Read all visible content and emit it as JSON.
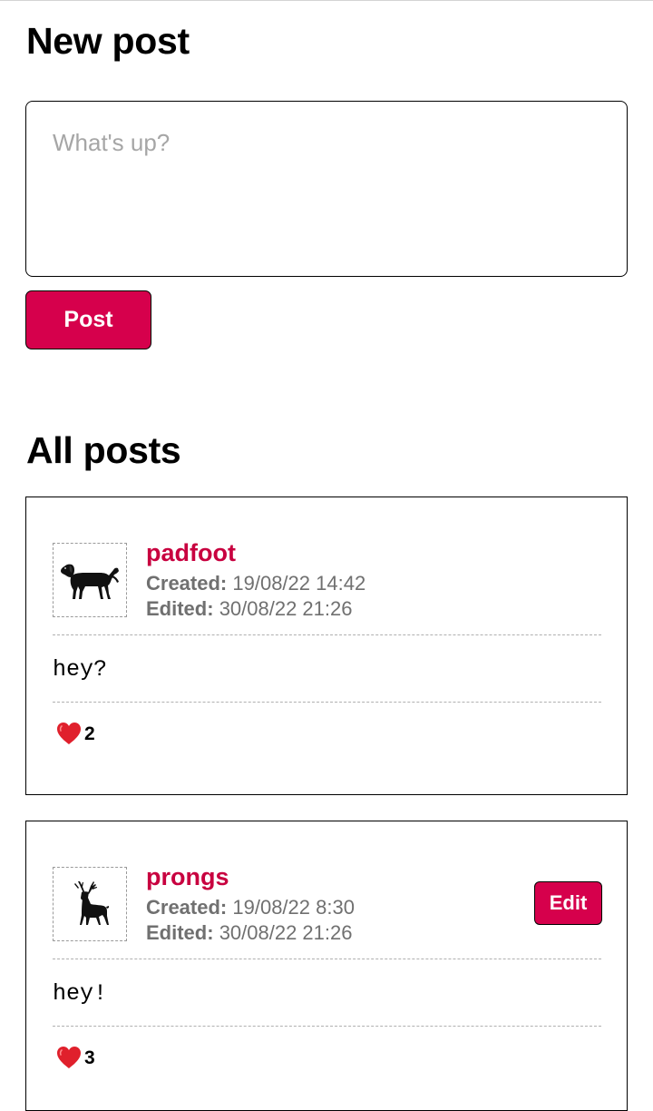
{
  "new_post": {
    "title": "New post",
    "placeholder": "What's up?",
    "value": "",
    "submit_label": "Post"
  },
  "feed": {
    "title": "All posts",
    "posts": [
      {
        "username": "padfoot",
        "avatar": "dog-icon",
        "created_label": "Created:",
        "created": "19/08/22 14:42",
        "edited_label": "Edited:",
        "edited": "30/08/22 21:26",
        "content": "hey?",
        "like_icon": "heart-icon",
        "likes": "2",
        "editable": false
      },
      {
        "username": "prongs",
        "avatar": "stag-icon",
        "created_label": "Created:",
        "created": "19/08/22 8:30",
        "edited_label": "Edited:",
        "edited": "30/08/22 21:26",
        "content": "hey!",
        "like_icon": "heart-icon",
        "likes": "3",
        "editable": true,
        "edit_label": "Edit"
      }
    ]
  },
  "colors": {
    "accent": "#d6004c",
    "username": "#c8003f",
    "meta_text": "#707070",
    "placeholder": "#a6a6a6",
    "heart": "#e0202c"
  }
}
